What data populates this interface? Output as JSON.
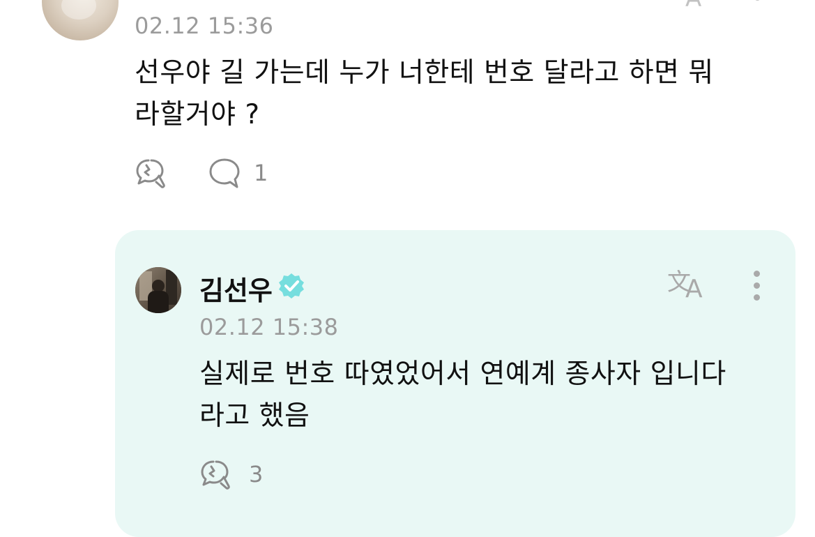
{
  "post": {
    "timestamp": "02.12 15:36",
    "text_line1": "선우야 길 가는데 누가 너한테 번호 달라고 하면 뭐",
    "text_line2": "라할거야 ?",
    "comment_count": "1"
  },
  "reply": {
    "author": "김선우",
    "verified": true,
    "timestamp": "02.12 15:38",
    "text_line1": "실제로 번호 따였었어서 연예계 종사자 입니다",
    "text_line2": "라고 했음",
    "like_count": "3"
  },
  "colors": {
    "reply_background": "#e9f8f5",
    "verified_badge": "#76dede",
    "muted_text": "#9b9b9b"
  },
  "icons": {
    "like": "like-bubble-icon",
    "comment": "comment-bubble-icon",
    "translate": "translate-icon",
    "more": "more-vertical-icon",
    "verified": "verified-badge-icon"
  }
}
